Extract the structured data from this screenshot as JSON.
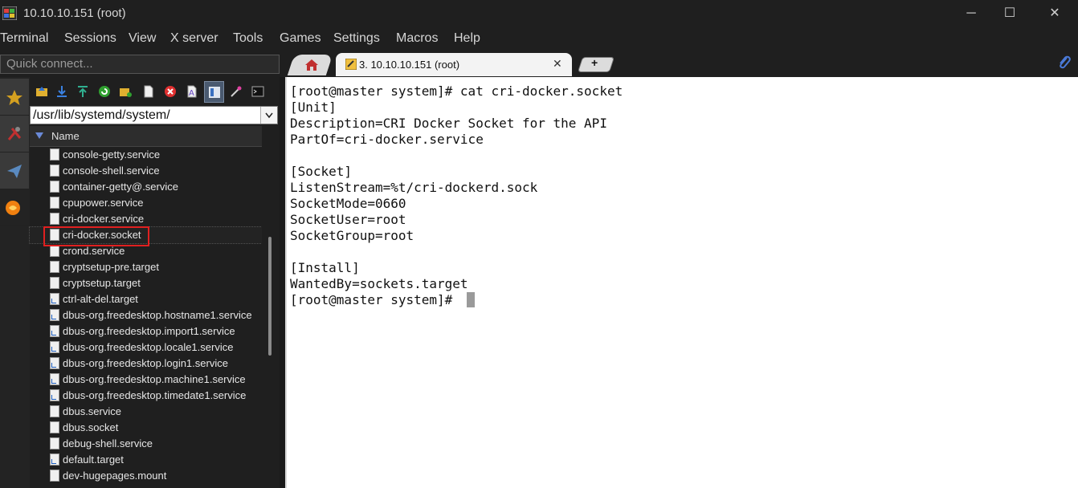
{
  "window": {
    "title": "10.10.10.151 (root)",
    "minimize_glyph": "─",
    "maximize_glyph": "☐",
    "close_glyph": "✕"
  },
  "menu": [
    "Terminal",
    "Sessions",
    "View",
    "X server",
    "Tools",
    "Games",
    "Settings",
    "Macros",
    "Help"
  ],
  "quick_connect": {
    "placeholder": "Quick connect..."
  },
  "tabs": {
    "home_icon": "home-icon",
    "active_label": "3. 10.10.10.151 (root)",
    "close_glyph": "✕",
    "new_tab_glyph": "+"
  },
  "sidebar": {
    "icons": [
      "star-icon",
      "tools-icon",
      "send-icon",
      "ball-icon"
    ]
  },
  "file_browser": {
    "path": "/usr/lib/systemd/system/",
    "column_header": "Name",
    "files": [
      {
        "name": "console-getty.service",
        "link": false
      },
      {
        "name": "console-shell.service",
        "link": false
      },
      {
        "name": "container-getty@.service",
        "link": false
      },
      {
        "name": "cpupower.service",
        "link": false
      },
      {
        "name": "cri-docker.service",
        "link": false
      },
      {
        "name": "cri-docker.socket",
        "link": false,
        "selected": true
      },
      {
        "name": "crond.service",
        "link": false
      },
      {
        "name": "cryptsetup-pre.target",
        "link": false
      },
      {
        "name": "cryptsetup.target",
        "link": false
      },
      {
        "name": "ctrl-alt-del.target",
        "link": true
      },
      {
        "name": "dbus-org.freedesktop.hostname1.service",
        "link": true
      },
      {
        "name": "dbus-org.freedesktop.import1.service",
        "link": true
      },
      {
        "name": "dbus-org.freedesktop.locale1.service",
        "link": true
      },
      {
        "name": "dbus-org.freedesktop.login1.service",
        "link": true
      },
      {
        "name": "dbus-org.freedesktop.machine1.service",
        "link": true
      },
      {
        "name": "dbus-org.freedesktop.timedate1.service",
        "link": true
      },
      {
        "name": "dbus.service",
        "link": false
      },
      {
        "name": "dbus.socket",
        "link": false
      },
      {
        "name": "debug-shell.service",
        "link": false
      },
      {
        "name": "default.target",
        "link": true
      },
      {
        "name": "dev-hugepages.mount",
        "link": false
      }
    ]
  },
  "terminal": {
    "lines": [
      "[root@master system]# cat cri-docker.socket",
      "[Unit]",
      "Description=CRI Docker Socket for the API",
      "PartOf=cri-docker.service",
      "",
      "[Socket]",
      "ListenStream=%t/cri-dockerd.sock",
      "SocketMode=0660",
      "SocketUser=root",
      "SocketGroup=root",
      "",
      "[Install]",
      "WantedBy=sockets.target",
      "[root@master system]# "
    ]
  },
  "colors": {
    "chrome_bg": "#1f1f1f",
    "terminal_bg": "#ffffff",
    "highlight": "#e02020"
  }
}
